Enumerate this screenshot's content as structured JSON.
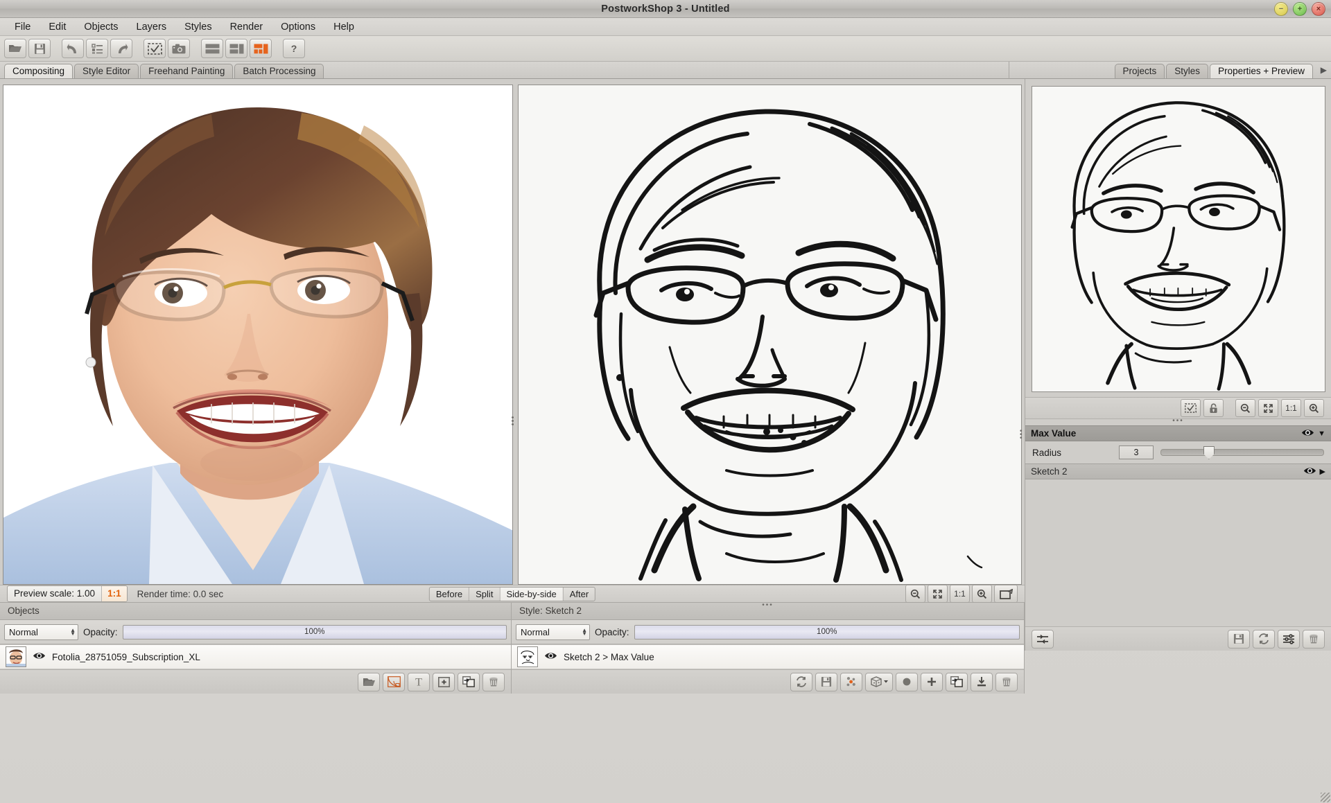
{
  "window": {
    "title": "PostworkShop 3 - Untitled",
    "controls": [
      {
        "name": "minimize",
        "glyph": "−"
      },
      {
        "name": "maximize",
        "glyph": "+"
      },
      {
        "name": "close",
        "glyph": "×"
      }
    ]
  },
  "menubar": [
    "File",
    "Edit",
    "Objects",
    "Layers",
    "Styles",
    "Render",
    "Options",
    "Help"
  ],
  "toolbar": [
    {
      "name": "open-icon",
      "title": "Open"
    },
    {
      "name": "save-icon",
      "title": "Save"
    },
    {
      "name": "undo-icon",
      "title": "Undo"
    },
    {
      "name": "history-list-icon",
      "title": "History"
    },
    {
      "name": "redo-icon",
      "title": "Redo"
    },
    {
      "name": "select-region-icon",
      "title": "Select"
    },
    {
      "name": "camera-icon",
      "title": "Snapshot"
    },
    {
      "name": "layout-horizontal-icon",
      "title": "Layout 1"
    },
    {
      "name": "layout-split-icon",
      "title": "Layout 2"
    },
    {
      "name": "layout-grid-active-icon",
      "title": "Layout 3"
    },
    {
      "name": "help-icon",
      "title": "Help"
    }
  ],
  "main_tabs": [
    {
      "label": "Compositing",
      "active": true
    },
    {
      "label": "Style Editor",
      "active": false
    },
    {
      "label": "Freehand Painting",
      "active": false
    },
    {
      "label": "Batch Processing",
      "active": false
    }
  ],
  "right_tabs": [
    {
      "label": "Projects",
      "active": false
    },
    {
      "label": "Styles",
      "active": false
    },
    {
      "label": "Properties + Preview",
      "active": true
    }
  ],
  "statusbar": {
    "preview_scale_label": "Preview scale: 1.00",
    "ratio_badge": "1:1",
    "render_time": "Render time: 0.0 sec",
    "view_modes": [
      {
        "label": "Before",
        "active": false
      },
      {
        "label": "Split",
        "active": false
      },
      {
        "label": "Side-by-side",
        "active": true
      },
      {
        "label": "After",
        "active": false
      }
    ],
    "zoom_buttons": [
      {
        "name": "zoom-out-icon",
        "label": ""
      },
      {
        "name": "fit-to-window-icon",
        "label": ""
      },
      {
        "name": "zoom-actual-size-button",
        "label": "1:1"
      },
      {
        "name": "zoom-in-icon",
        "label": ""
      },
      {
        "name": "popout-window-icon",
        "label": ""
      }
    ]
  },
  "objects_panel": {
    "header": "Objects",
    "blend_mode": "Normal",
    "blend_options": [
      "Normal"
    ],
    "opacity_label": "Opacity:",
    "opacity_value": "100%",
    "layers": [
      {
        "name": "Fotolia_28751059_Subscription_XL",
        "visible": true
      }
    ],
    "footer_buttons": [
      {
        "name": "open-file-icon"
      },
      {
        "name": "vector-shape-icon"
      },
      {
        "name": "add-text-icon"
      },
      {
        "name": "add-object-icon"
      },
      {
        "name": "duplicate-object-icon"
      },
      {
        "name": "delete-object-icon"
      }
    ]
  },
  "style_panel": {
    "header": "Style: Sketch 2",
    "blend_mode": "Normal",
    "opacity_label": "Opacity:",
    "opacity_value": "100%",
    "layers": [
      {
        "name": "Sketch 2 > Max Value",
        "visible": true
      }
    ],
    "footer_buttons": [
      {
        "name": "refresh-style-icon"
      },
      {
        "name": "save-style-icon"
      },
      {
        "name": "randomize-icon"
      },
      {
        "name": "dice-variant-icon"
      },
      {
        "name": "add-filter-circle-icon"
      },
      {
        "name": "add-layer-icon"
      },
      {
        "name": "duplicate-layer-icon"
      },
      {
        "name": "import-style-icon"
      },
      {
        "name": "delete-layer-icon"
      }
    ]
  },
  "properties_panel": {
    "preview_toolbar": [
      {
        "name": "select-region-icon"
      },
      {
        "name": "lock-icon"
      },
      {
        "name": "zoom-out-icon"
      },
      {
        "name": "fit-to-window-icon"
      },
      {
        "name": "zoom-actual-size-button",
        "label": "1:1"
      },
      {
        "name": "zoom-in-icon"
      }
    ],
    "zoom_label": "1:1",
    "sections": [
      {
        "title": "Max Value",
        "expanded": true,
        "params": [
          {
            "label": "Radius",
            "value": "3",
            "slider_pct": 29
          }
        ]
      },
      {
        "title": "Sketch 2",
        "expanded": false,
        "params": []
      }
    ],
    "footer_left": [
      {
        "name": "parameter-sliders-icon"
      }
    ],
    "footer_right": [
      {
        "name": "save-preset-icon"
      },
      {
        "name": "refresh-preset-icon"
      },
      {
        "name": "edit-parameters-icon"
      },
      {
        "name": "delete-preset-icon"
      }
    ]
  }
}
